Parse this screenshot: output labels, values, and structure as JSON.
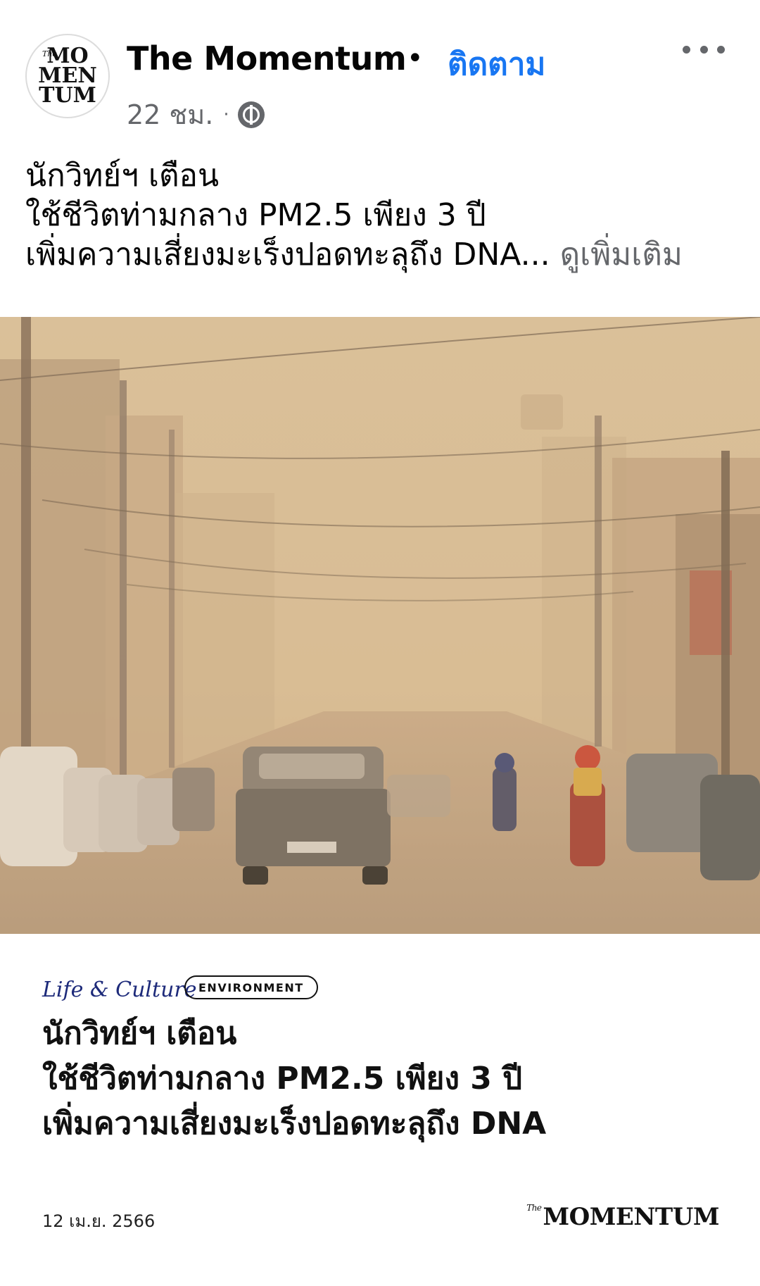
{
  "post": {
    "page_name": "The Momentum",
    "separator": "•",
    "follow_label": "ติดตาม",
    "time": "22 ชม.",
    "time_separator": "·",
    "avatar": {
      "the": "The",
      "line1": "MO",
      "line2": "MEN",
      "line3": "TUM"
    }
  },
  "caption": {
    "line1": "นักวิทย์ฯ เตือน",
    "line2": "ใช้ชีวิตท่ามกลาง PM2.5 เพียง 3 ปี",
    "line3": "เพิ่มความเสี่ยงมะเร็งปอดทะลุถึง DNA...",
    "see_more": "ดูเพิ่มเติม"
  },
  "card": {
    "section": "Life & Culture",
    "tag": "ENVIRONMENT",
    "headline_line1": "นักวิทย์ฯ เตือน",
    "headline_line2": "ใช้ชีวิตท่ามกลาง PM2.5 เพียง 3 ปี",
    "headline_line3": "เพิ่มความเสี่ยงมะเร็งปอดทะลุถึง DNA",
    "date": "12 เม.ย. 2566",
    "brand_the": "The",
    "brand_name": "MOMENTUM"
  },
  "colors": {
    "follow": "#1876f2",
    "meta": "#65676b",
    "section": "#1d2a7a",
    "haze": "#d9bf98"
  }
}
